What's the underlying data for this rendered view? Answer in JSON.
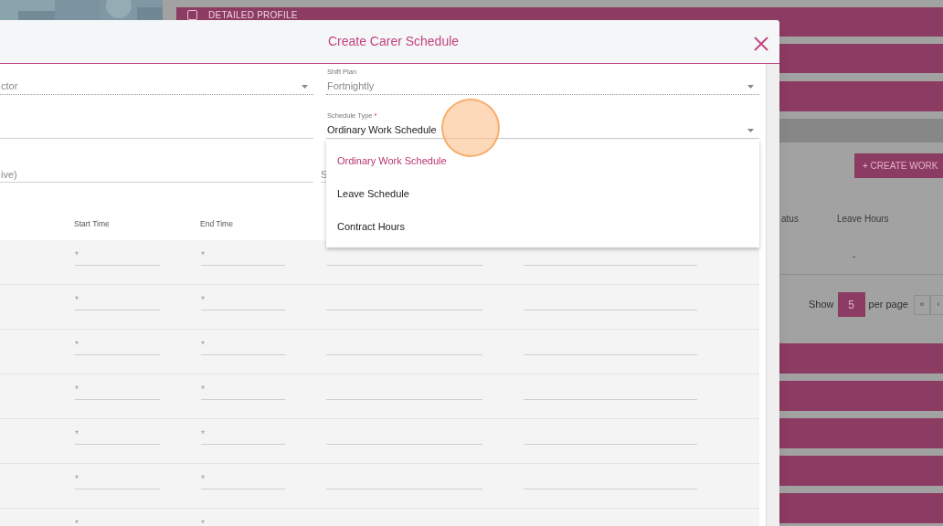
{
  "background_page": {
    "section_title": "DETAILED PROFILE",
    "section_checked": false,
    "create_button": "+ CREATE WORK",
    "columns": [
      "atus",
      "Leave Hours"
    ],
    "row": {
      "leave_hours": "-"
    },
    "pagination": {
      "show_label": "Show",
      "per_page_value": "5",
      "per_page_label": "per page",
      "buttons": [
        "«",
        "‹"
      ]
    }
  },
  "modal": {
    "title": "Create Carer Schedule",
    "fields": [
      {
        "kind": "select",
        "value": "ctor",
        "disabled": true
      },
      {
        "kind": "select",
        "label": "Shift Plan",
        "value": "Fortnightly",
        "disabled": true
      },
      {
        "kind": "text",
        "disabled": false
      },
      {
        "kind": "select",
        "label": "Schedule Type",
        "required_mark": "*",
        "value": "Ordinary Work Schedule",
        "disabled": false,
        "expanded": true
      },
      {
        "kind": "text",
        "placeholder": "ive)",
        "disabled": false
      },
      {
        "kind": "text",
        "placeholder": "S",
        "disabled": false
      }
    ],
    "dropdown": {
      "options": [
        {
          "label": "Ordinary Work Schedule",
          "selected": true
        },
        {
          "label": "Leave Schedule",
          "selected": false
        },
        {
          "label": "Contract Hours",
          "selected": false
        }
      ]
    },
    "table": {
      "columns": [
        "Start Time",
        "End Time"
      ],
      "rows": [
        {
          "start_placeholder": "*",
          "end_placeholder": "*"
        },
        {
          "start_placeholder": "*",
          "end_placeholder": "*"
        },
        {
          "start_placeholder": "*",
          "end_placeholder": "*"
        },
        {
          "start_placeholder": "*",
          "end_placeholder": "*"
        },
        {
          "start_placeholder": "*",
          "end_placeholder": "*"
        },
        {
          "start_placeholder": "*",
          "end_placeholder": "*"
        },
        {
          "start_placeholder": "*",
          "end_placeholder": "*"
        }
      ]
    }
  }
}
